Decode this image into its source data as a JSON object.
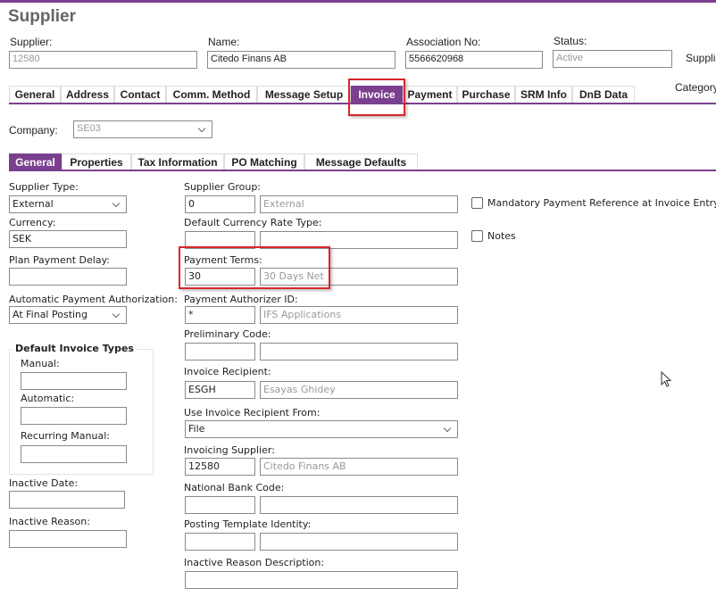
{
  "header": {
    "title": "Supplier",
    "supplier_label": "Supplier:",
    "supplier_value": "12580",
    "name_label": "Name:",
    "name_value": "Citedo Finans AB",
    "assoc_label": "Association No:",
    "assoc_value": "5566620968",
    "status_label": "Status:",
    "status_value": "Active",
    "right_cut_label": "Supplie",
    "category_label": "Category"
  },
  "main_tabs": [
    "General",
    "Address",
    "Contact",
    "Comm. Method",
    "Message Setup",
    "Invoice",
    "Payment",
    "Purchase",
    "SRM Info",
    "DnB Data"
  ],
  "company": {
    "label": "Company:",
    "value": "SE03"
  },
  "sub_tabs": [
    "General",
    "Properties",
    "Tax Information",
    "PO Matching",
    "Message Defaults"
  ],
  "left": {
    "supplier_type_label": "Supplier Type:",
    "supplier_type_value": "External",
    "currency_label": "Currency:",
    "currency_value": "SEK",
    "plan_delay_label": "Plan Payment Delay:",
    "auto_auth_label": "Automatic Payment Authorization:",
    "auto_auth_value": "At Final Posting",
    "group_title": "Default Invoice Types",
    "manual_label": "Manual:",
    "automatic_label": "Automatic:",
    "recurring_label": "Recurring Manual:",
    "inactive_date_label": "Inactive Date:",
    "inactive_reason_label": "Inactive Reason:"
  },
  "mid": {
    "supplier_group_label": "Supplier Group:",
    "supplier_group_code": "0",
    "supplier_group_desc": "External",
    "rate_type_label": "Default Currency Rate Type:",
    "payment_terms_label": "Payment Terms:",
    "payment_terms_code": "30",
    "payment_terms_desc": "30 Days Net",
    "authorizer_label": "Payment Authorizer ID:",
    "authorizer_code": "*",
    "authorizer_desc": "IFS Applications",
    "prelim_label": "Preliminary Code:",
    "recipient_label": "Invoice Recipient:",
    "recipient_code": "ESGH",
    "recipient_desc": "Esayas Ghidey",
    "use_recipient_label": "Use Invoice Recipient From:",
    "use_recipient_value": "File",
    "invoicing_supplier_label": "Invoicing Supplier:",
    "invoicing_supplier_code": "12580",
    "invoicing_supplier_desc": "Citedo Finans AB",
    "bank_code_label": "National Bank Code:",
    "posting_template_label": "Posting Template Identity:",
    "inactive_desc_label": "Inactive Reason Description:"
  },
  "right": {
    "mandatory_ref_label": "Mandatory Payment Reference at Invoice Entry",
    "notes_label": "Notes"
  }
}
